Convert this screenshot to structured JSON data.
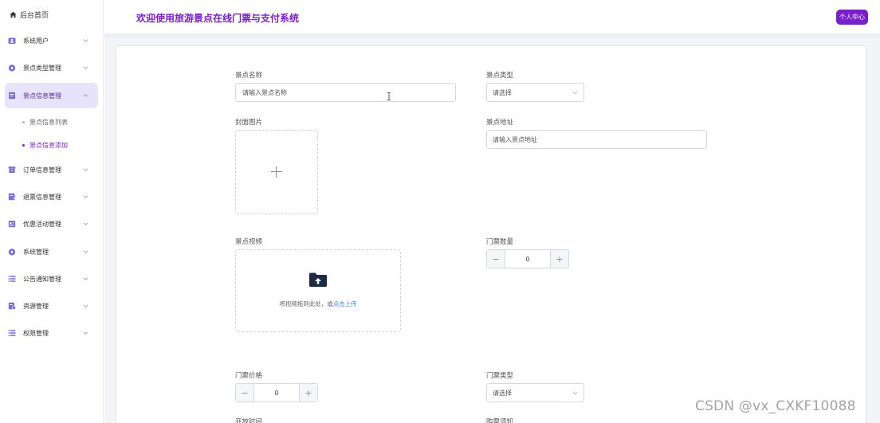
{
  "app": {
    "title": "欢迎使用旅游景点在线门票与支付系统",
    "user_center": "个人中心",
    "accent_color": "#7a1fcc"
  },
  "sidebar": {
    "home": {
      "label": "后台首页",
      "icon": "home-icon"
    },
    "items": [
      {
        "label": "系统用户",
        "icon": "user-icon",
        "expanded": false
      },
      {
        "label": "景点类型管理",
        "icon": "tag-icon",
        "expanded": false
      },
      {
        "label": "景点信息管理",
        "icon": "document-icon",
        "expanded": true
      },
      {
        "label": "订单信息管理",
        "icon": "box-icon",
        "expanded": false
      },
      {
        "label": "退票信息管理",
        "icon": "edit-icon",
        "expanded": false
      },
      {
        "label": "优惠活动管理",
        "icon": "calendar-icon",
        "expanded": false
      },
      {
        "label": "系统管理",
        "icon": "settings-icon",
        "expanded": false
      },
      {
        "label": "公告通知管理",
        "icon": "list-icon",
        "expanded": false
      },
      {
        "label": "资源管理",
        "icon": "folder-icon",
        "expanded": false
      },
      {
        "label": "权限管理",
        "icon": "list-icon",
        "expanded": false
      }
    ],
    "subitems": [
      {
        "label": "景点信息列表",
        "active": false
      },
      {
        "label": "景点信息添加",
        "active": true
      }
    ]
  },
  "form": {
    "name": {
      "label": "景点名称",
      "placeholder": "请输入景点名称"
    },
    "type": {
      "label": "景点类型",
      "placeholder": "请选择"
    },
    "cover": {
      "label": "封面图片"
    },
    "address": {
      "label": "景点地址",
      "placeholder": "请输入景点地址"
    },
    "video": {
      "label": "景点视频",
      "hint": "将视频拖到此处，或",
      "link": "点击上传"
    },
    "ticket_count": {
      "label": "门票数量",
      "value": "0"
    },
    "ticket_price": {
      "label": "门票价格",
      "value": "0"
    },
    "ticket_type": {
      "label": "门票类型",
      "placeholder": "请选择"
    },
    "open_time": {
      "label": "开放时间"
    },
    "purchase_notice": {
      "label": "购票须知"
    }
  },
  "watermark": "CSDN @vx_CXKF10088"
}
